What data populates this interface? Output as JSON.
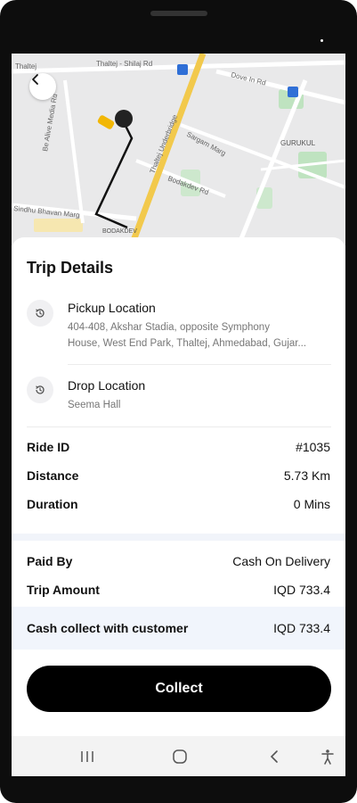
{
  "map": {
    "street_labels": [
      "Thaltej",
      "Thaltej - Shilaj Rd",
      "Dove In Rd",
      "Be Alive Media Rd",
      "Thaltej Underbridge",
      "Sargam Marg",
      "Bodakdev Rd",
      "GURUKUL",
      "Sindhu Bhavan Marg",
      "BODAKDEV"
    ]
  },
  "trip": {
    "title": "Trip Details",
    "pickup": {
      "title": "Pickup Location",
      "address_line1": "404-408, Akshar Stadia, opposite Symphony",
      "address_line2": "House, West End Park, Thaltej, Ahmedabad, Gujar..."
    },
    "drop": {
      "title": "Drop Location",
      "address": "Seema Hall"
    },
    "rows": [
      {
        "label": "Ride ID",
        "value": "#1035"
      },
      {
        "label": "Distance",
        "value": "5.73 Km"
      },
      {
        "label": "Duration",
        "value": "0 Mins"
      }
    ],
    "payment": [
      {
        "label": "Paid By",
        "value": "Cash On Delivery"
      },
      {
        "label": "Trip Amount",
        "value": "IQD 733.4"
      }
    ],
    "cash_collect": {
      "label": "Cash collect with customer",
      "value": "IQD 733.4"
    },
    "collect_button": "Collect"
  },
  "icons": {
    "back": "chevron-left-icon",
    "pickup": "history-icon",
    "drop": "history-icon",
    "nav_recent": "recent-apps-icon",
    "nav_home": "home-icon",
    "nav_back": "back-icon",
    "nav_accessibility": "accessibility-icon"
  },
  "colors": {
    "button": "#000000",
    "highlight": "#f1f5fc",
    "map_road_major": "#f2c94c",
    "map_park": "#bfe3c0"
  }
}
